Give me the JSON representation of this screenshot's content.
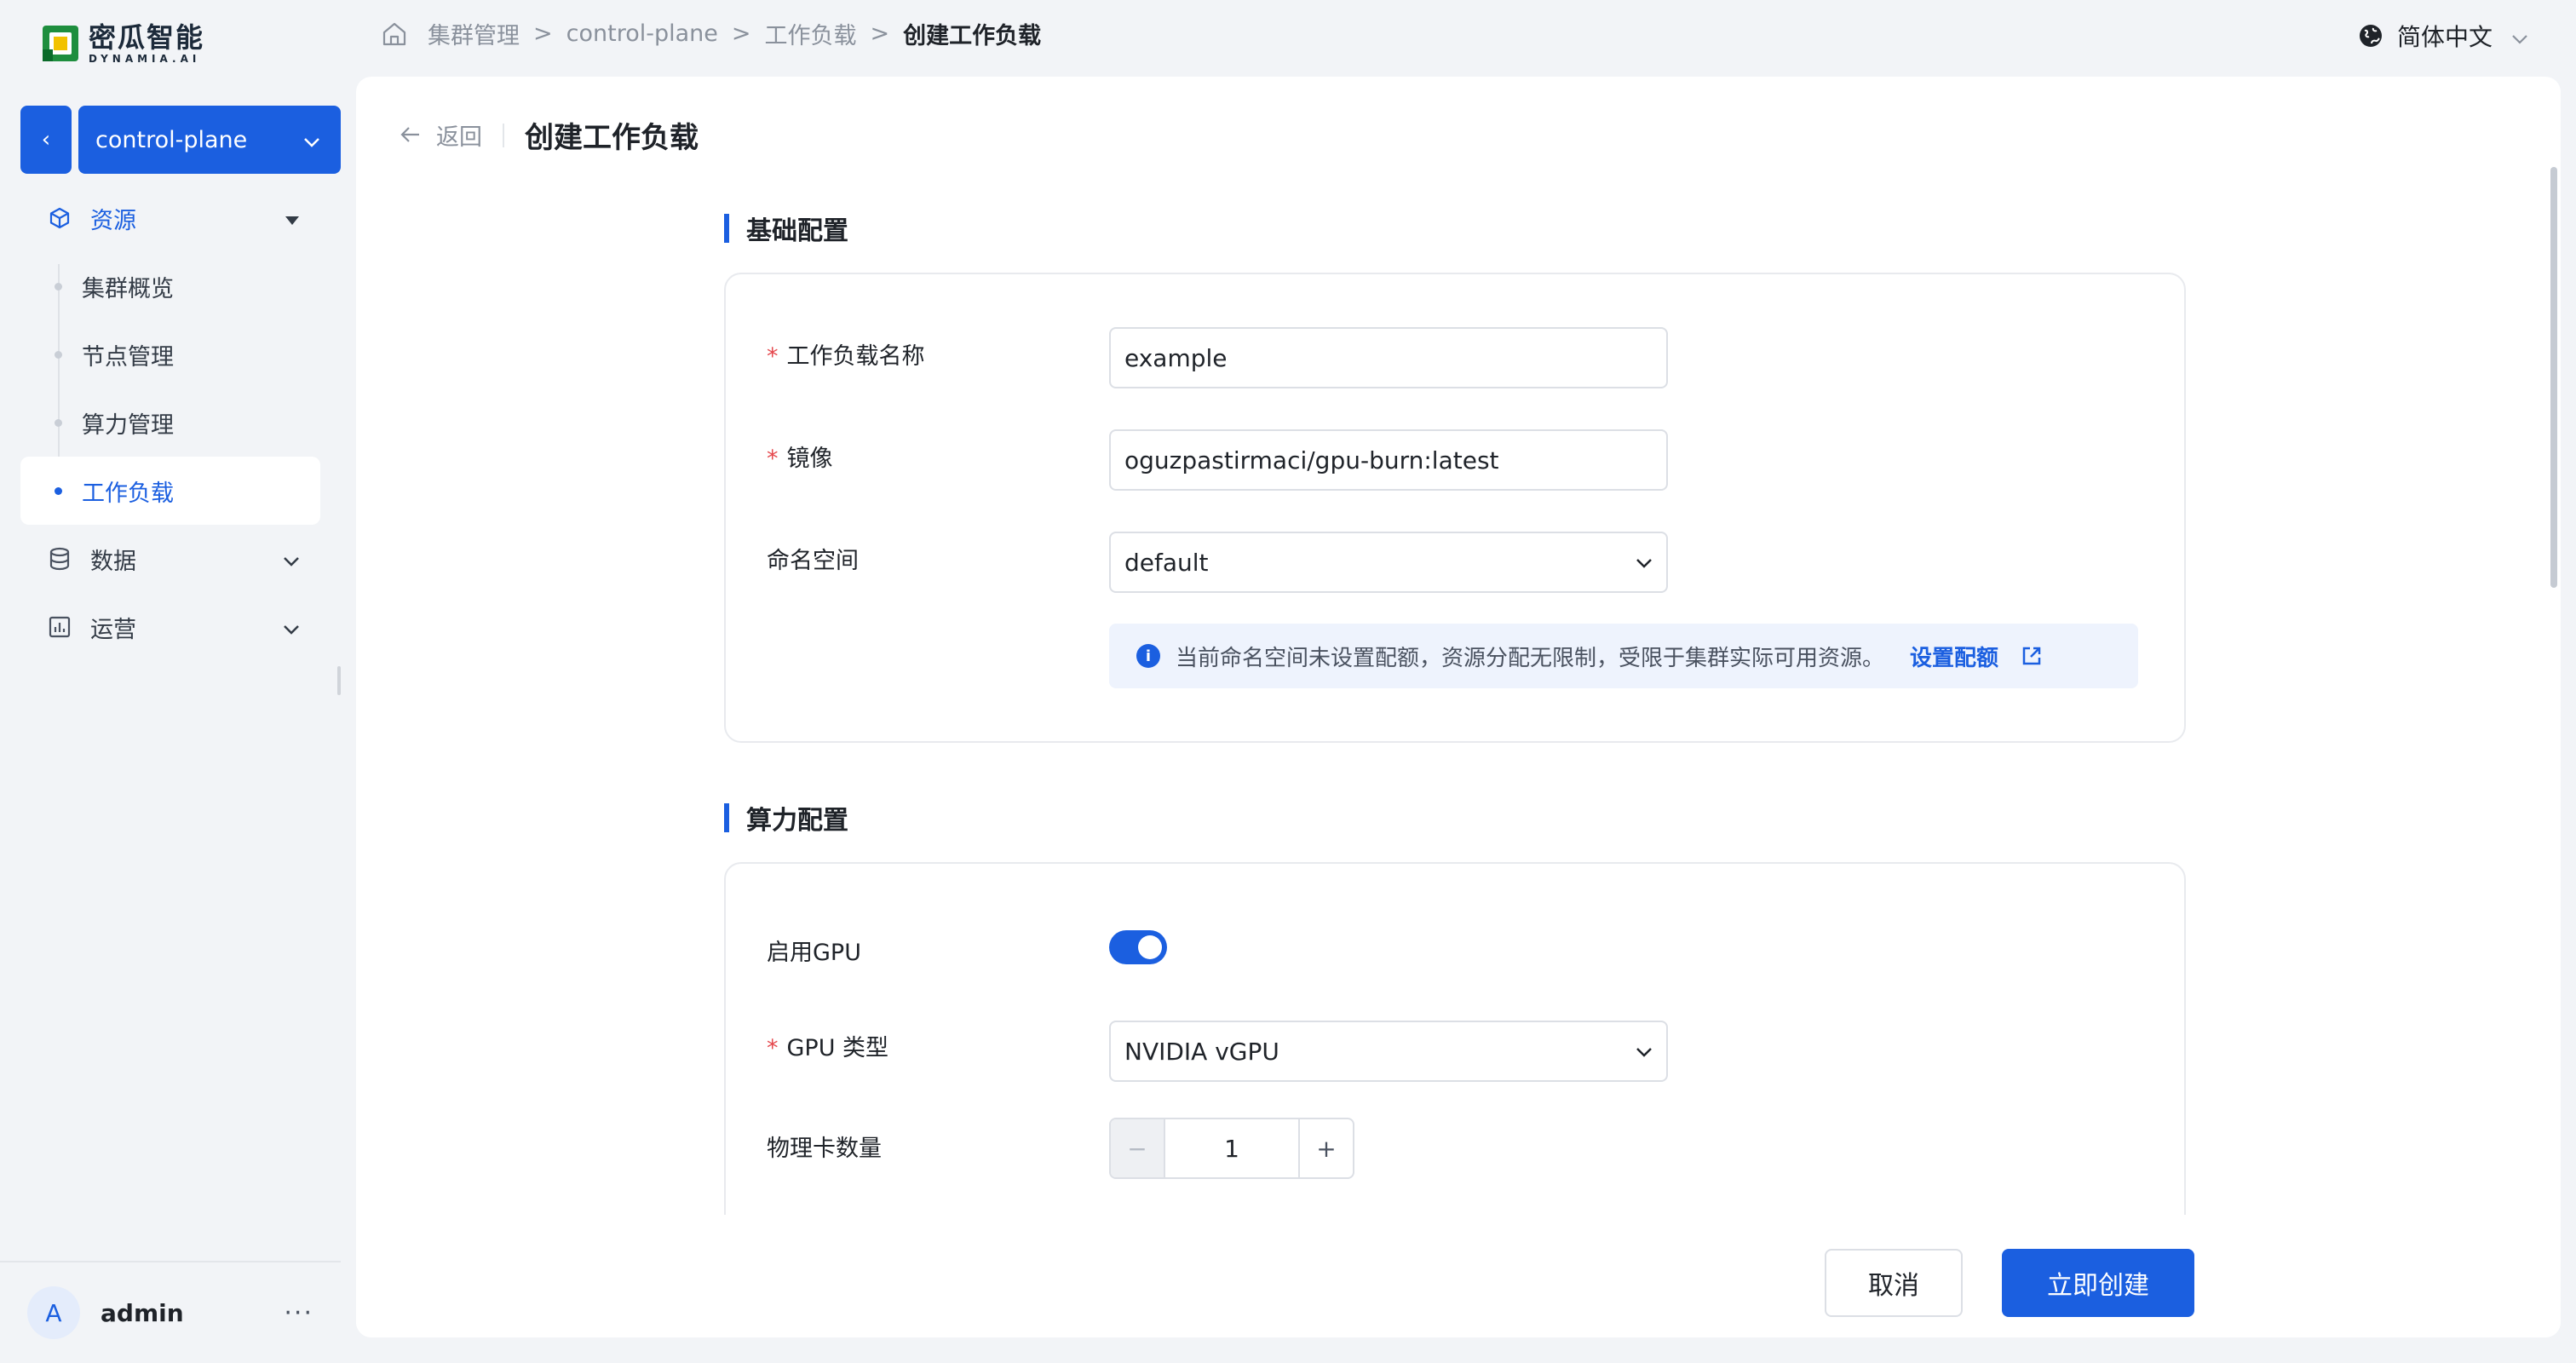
{
  "brand": {
    "name_cn": "密瓜智能",
    "name_en": "DYNAMIA.AI"
  },
  "cluster": {
    "name": "control-plane"
  },
  "sidebar": {
    "groups": [
      {
        "label": "资源",
        "icon": "cube-icon",
        "expanded": true
      },
      {
        "label": "数据",
        "icon": "database-icon",
        "expanded": false
      },
      {
        "label": "运营",
        "icon": "chart-icon",
        "expanded": false
      }
    ],
    "sub_items": [
      "集群概览",
      "节点管理",
      "算力管理",
      "工作负载"
    ],
    "active_sub_item": "工作负载"
  },
  "user": {
    "initial": "A",
    "name": "admin",
    "more": "···"
  },
  "breadcrumb": {
    "items": [
      "集群管理",
      "control-plane",
      "工作负载",
      "创建工作负载"
    ],
    "separator": ">"
  },
  "language": {
    "label": "简体中文"
  },
  "page": {
    "back_label": "返回",
    "title": "创建工作负载"
  },
  "basic_config": {
    "title": "基础配置",
    "name_label": "工作负载名称",
    "name_value": "example",
    "image_label": "镜像",
    "image_value": "oguzpastirmaci/gpu-burn:latest",
    "namespace_label": "命名空间",
    "namespace_value": "default",
    "required_mark": "*",
    "info_text": "当前命名空间未设置配额，资源分配无限制，受限于集群实际可用资源。",
    "info_link": "设置配额"
  },
  "compute_config": {
    "title": "算力配置",
    "gpu_enable_label": "启用GPU",
    "gpu_enabled": true,
    "gpu_type_label": "GPU 类型",
    "gpu_type_value": "NVIDIA vGPU",
    "card_count_label": "物理卡数量",
    "card_count_value": "1"
  },
  "footer": {
    "cancel_label": "取消",
    "create_label": "立即创建"
  },
  "colors": {
    "accent": "#1b5fe0",
    "required": "#e5484d",
    "background": "#f2f4f7"
  }
}
